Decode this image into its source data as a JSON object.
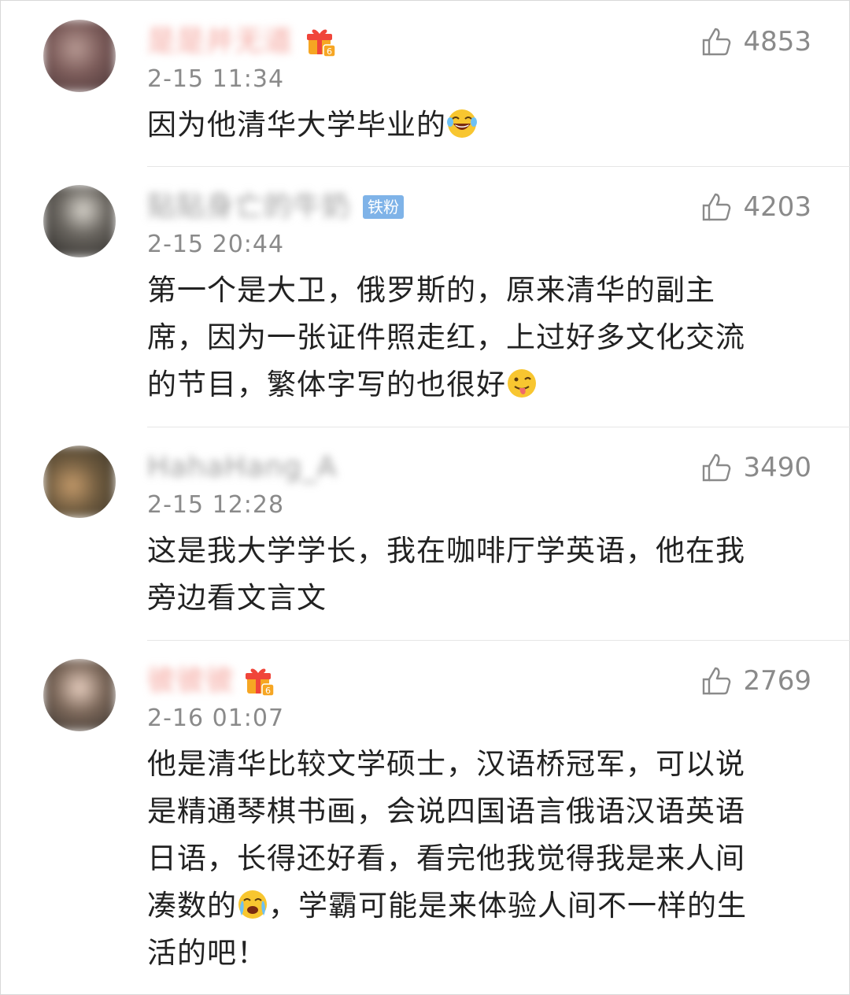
{
  "comments": [
    {
      "username": "是是并无道",
      "time": "2-15 11:34",
      "likes": "4853",
      "text": "因为他清华大学毕业的",
      "emoji": "laughing-tears-emoji",
      "badge": "gift-level-6"
    },
    {
      "username": "贴贴身亡的牛奶",
      "time": "2-15 20:44",
      "likes": "4203",
      "text_lines": [
        "第一个是大卫，俄罗斯的，原来清华的副主",
        "席，因为一张证件照走红，上过好多文化交流",
        "的节目，繁体字写的也很好"
      ],
      "emoji": "tongue-out-emoji",
      "badge_label": "铁粉"
    },
    {
      "username": "HahaHang_A",
      "time": "2-15 12:28",
      "likes": "3490",
      "text_lines": [
        "这是我大学学长，我在咖啡厅学英语，他在我",
        "旁边看文言文"
      ]
    },
    {
      "username": "彼彼彼",
      "time": "2-16 01:07",
      "likes": "2769",
      "text_lines": [
        "他是清华比较文学硕士，汉语桥冠军，可以说",
        "是精通琴棋书画，会说四国语言俄语汉语英语",
        "日语，长得还好看，看完他我觉得我是来人间",
        "凑数的",
        "，学霸可能是来体验人间不一样的生",
        "活的吧！"
      ],
      "emoji": "crying-emoji",
      "badge": "gift-level-6"
    }
  ],
  "colors": {
    "text": "#222222",
    "meta": "#8a8a8a",
    "username": "#f28b82",
    "fan_badge": "#7fb3e8"
  },
  "icons": {
    "like": "thumbs-up-icon",
    "gift": "gift-badge-icon"
  }
}
